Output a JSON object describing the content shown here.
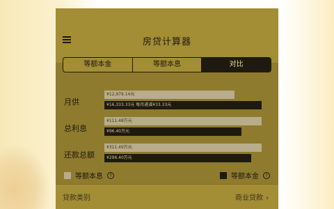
{
  "header": {
    "title": "房贷计算器"
  },
  "tabs": [
    {
      "label": "等额本金",
      "active": false
    },
    {
      "label": "等额本息",
      "active": false
    },
    {
      "label": "对比",
      "active": true
    }
  ],
  "rows": [
    {
      "label": "月供",
      "light_text": "¥12,979.14元",
      "light_fraction": 0.78,
      "dark_text": "¥16,333.33元 每月递减¥33.33元",
      "dark_fraction": 0.94
    },
    {
      "label": "总利息",
      "light_text": "¥111.48万元",
      "light_fraction": 0.94,
      "dark_text": "¥96.40万元",
      "dark_fraction": 0.82
    },
    {
      "label": "还款总额",
      "light_text": "¥311.49万元",
      "light_fraction": 0.94,
      "dark_text": "¥296.40万元",
      "dark_fraction": 0.88
    }
  ],
  "legend": {
    "left_label": "等额本息",
    "right_label": "等额本金"
  },
  "loan": {
    "label": "贷款类别",
    "value": "商业贷款"
  },
  "colors": {
    "accent": "#a38d35",
    "dark": "#1e1a10",
    "light_bar": "#b7ad8a"
  }
}
